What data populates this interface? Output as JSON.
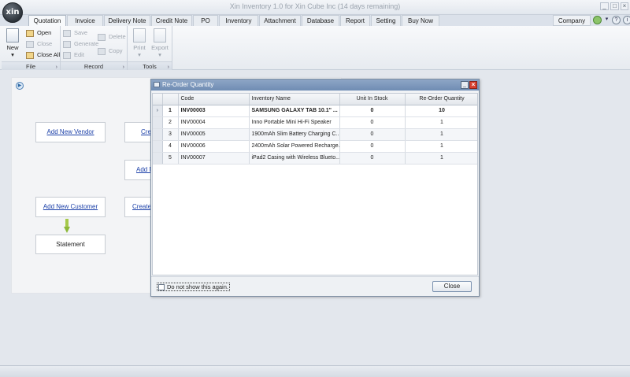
{
  "window": {
    "title": "Xin Inventory 1.0 for Xin Cube Inc (14 days remaining)",
    "logo": "xin"
  },
  "tabs": [
    {
      "label": "Quotation",
      "active": true
    },
    {
      "label": "Invoice"
    },
    {
      "label": "Delivery Note"
    },
    {
      "label": "Credit Note"
    },
    {
      "label": "PO"
    },
    {
      "label": "Inventory"
    },
    {
      "label": "Attachment"
    },
    {
      "label": "Database"
    },
    {
      "label": "Report"
    },
    {
      "label": "Setting"
    },
    {
      "label": "Buy Now"
    }
  ],
  "company_tab": "Company",
  "ribbon": {
    "file": {
      "label": "File",
      "new": "New",
      "open": "Open",
      "close": "Close",
      "close_all": "Close All"
    },
    "record": {
      "label": "Record",
      "save": "Save",
      "generate": "Generate",
      "edit": "Edit",
      "delete": "Delete",
      "copy": "Copy"
    },
    "tools": {
      "label": "Tools",
      "print": "Print",
      "export": "Export"
    }
  },
  "workflow": {
    "add_new_vendor": "Add New Vendor",
    "create_1": "Cre",
    "add_n": "Add N",
    "add_new_customer": "Add New Customer",
    "create_2": "Create",
    "statement": "Statement"
  },
  "dialog": {
    "title": "Re-Order Quantity",
    "columns": [
      "Code",
      "Inventory Name",
      "Unit In Stock",
      "Re-Order Quantity"
    ],
    "rows": [
      {
        "no": "1",
        "code": "INV00003",
        "name": "SAMSUNG GALAXY TAB 10.1\" ...",
        "stock": "0",
        "reorder": "10"
      },
      {
        "no": "2",
        "code": "INV00004",
        "name": "Inno Portable Mini Hi-Fi Speaker",
        "stock": "0",
        "reorder": "1"
      },
      {
        "no": "3",
        "code": "INV00005",
        "name": "1900mAh Slim Battery Charging C...",
        "stock": "0",
        "reorder": "1"
      },
      {
        "no": "4",
        "code": "INV00006",
        "name": "2400mAh Solar Powered Recharge...",
        "stock": "0",
        "reorder": "1"
      },
      {
        "no": "5",
        "code": "INV00007",
        "name": "iPad2 Casing with Wireless Blueto...",
        "stock": "0",
        "reorder": "1"
      }
    ],
    "checkbox_label": "Do not show this again.",
    "close_label": "Close"
  }
}
